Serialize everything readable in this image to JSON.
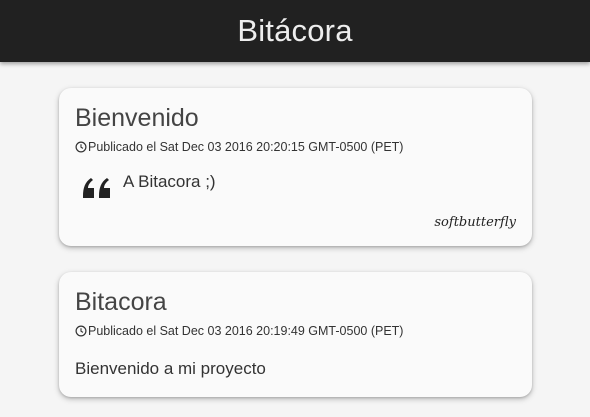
{
  "app": {
    "title": "Bitácora"
  },
  "posts": [
    {
      "title": "Bienvenido",
      "meta": "Publicado el Sat Dec 03 2016 20:20:15 GMT-0500 (PET)",
      "quote": "A Bitacora ;)",
      "author": "softbutterfly"
    },
    {
      "title": "Bitacora",
      "meta": "Publicado el Sat Dec 03 2016 20:19:49 GMT-0500 (PET)",
      "body": "Bienvenido a mi proyecto"
    }
  ],
  "icons": {
    "clock": "clock-icon",
    "quote": "quote-icon"
  },
  "colors": {
    "topbar": "#212121",
    "background": "#f5f5f5",
    "card": "#fafafa"
  }
}
